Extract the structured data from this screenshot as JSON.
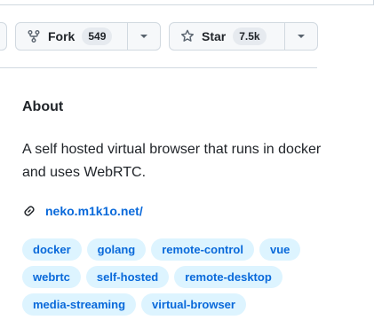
{
  "fork": {
    "label": "Fork",
    "count": "549"
  },
  "star": {
    "label": "Star",
    "count": "7.5k"
  },
  "about": {
    "title": "About",
    "description": "A self hosted virtual browser that runs in docker and uses WebRTC.",
    "link": "neko.m1k1o.net/"
  },
  "topics": [
    "docker",
    "golang",
    "remote-control",
    "vue",
    "webrtc",
    "self-hosted",
    "remote-desktop",
    "media-streaming",
    "virtual-browser"
  ],
  "colors": {
    "accent": "#0969da",
    "topic_bg": "#ddf4ff",
    "button_bg": "#f6f8fa",
    "border": "#d1d9e0"
  },
  "icons": {
    "fork": "repo-forked-icon",
    "star": "star-icon",
    "dropdown": "triangle-down-icon",
    "link": "link-icon"
  }
}
